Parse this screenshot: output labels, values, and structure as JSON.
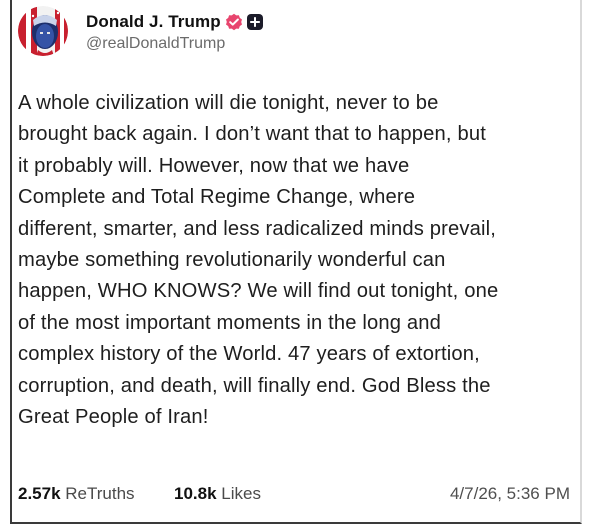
{
  "post": {
    "author": {
      "display_name": "Donald J. Trump",
      "handle": "@realDonaldTrump",
      "verified_icon": "verified-badge-icon",
      "badge_icon": "plus-badge-icon",
      "accent_color": "#e8456e"
    },
    "body_lines": [
      "A whole civilization will die tonight, never to be",
      "brought back again. I don’t want that to happen, but",
      "it probably will. However, now that we have",
      "Complete and Total Regime Change, where",
      "different, smarter, and less radicalized minds prevail,",
      "maybe something revolutionarily wonderful can",
      "happen, WHO KNOWS? We will find out tonight, one",
      "of the most important moments in the long and",
      "complex history of the World. 47 years of extortion,",
      "corruption, and death, will finally end. God Bless the",
      "Great People of Iran!"
    ],
    "stats": {
      "retruths_count": "2.57k",
      "retruths_label": "ReTruths",
      "likes_count": "10.8k",
      "likes_label": "Likes"
    },
    "timestamp": "4/7/26, 5:36 PM"
  }
}
